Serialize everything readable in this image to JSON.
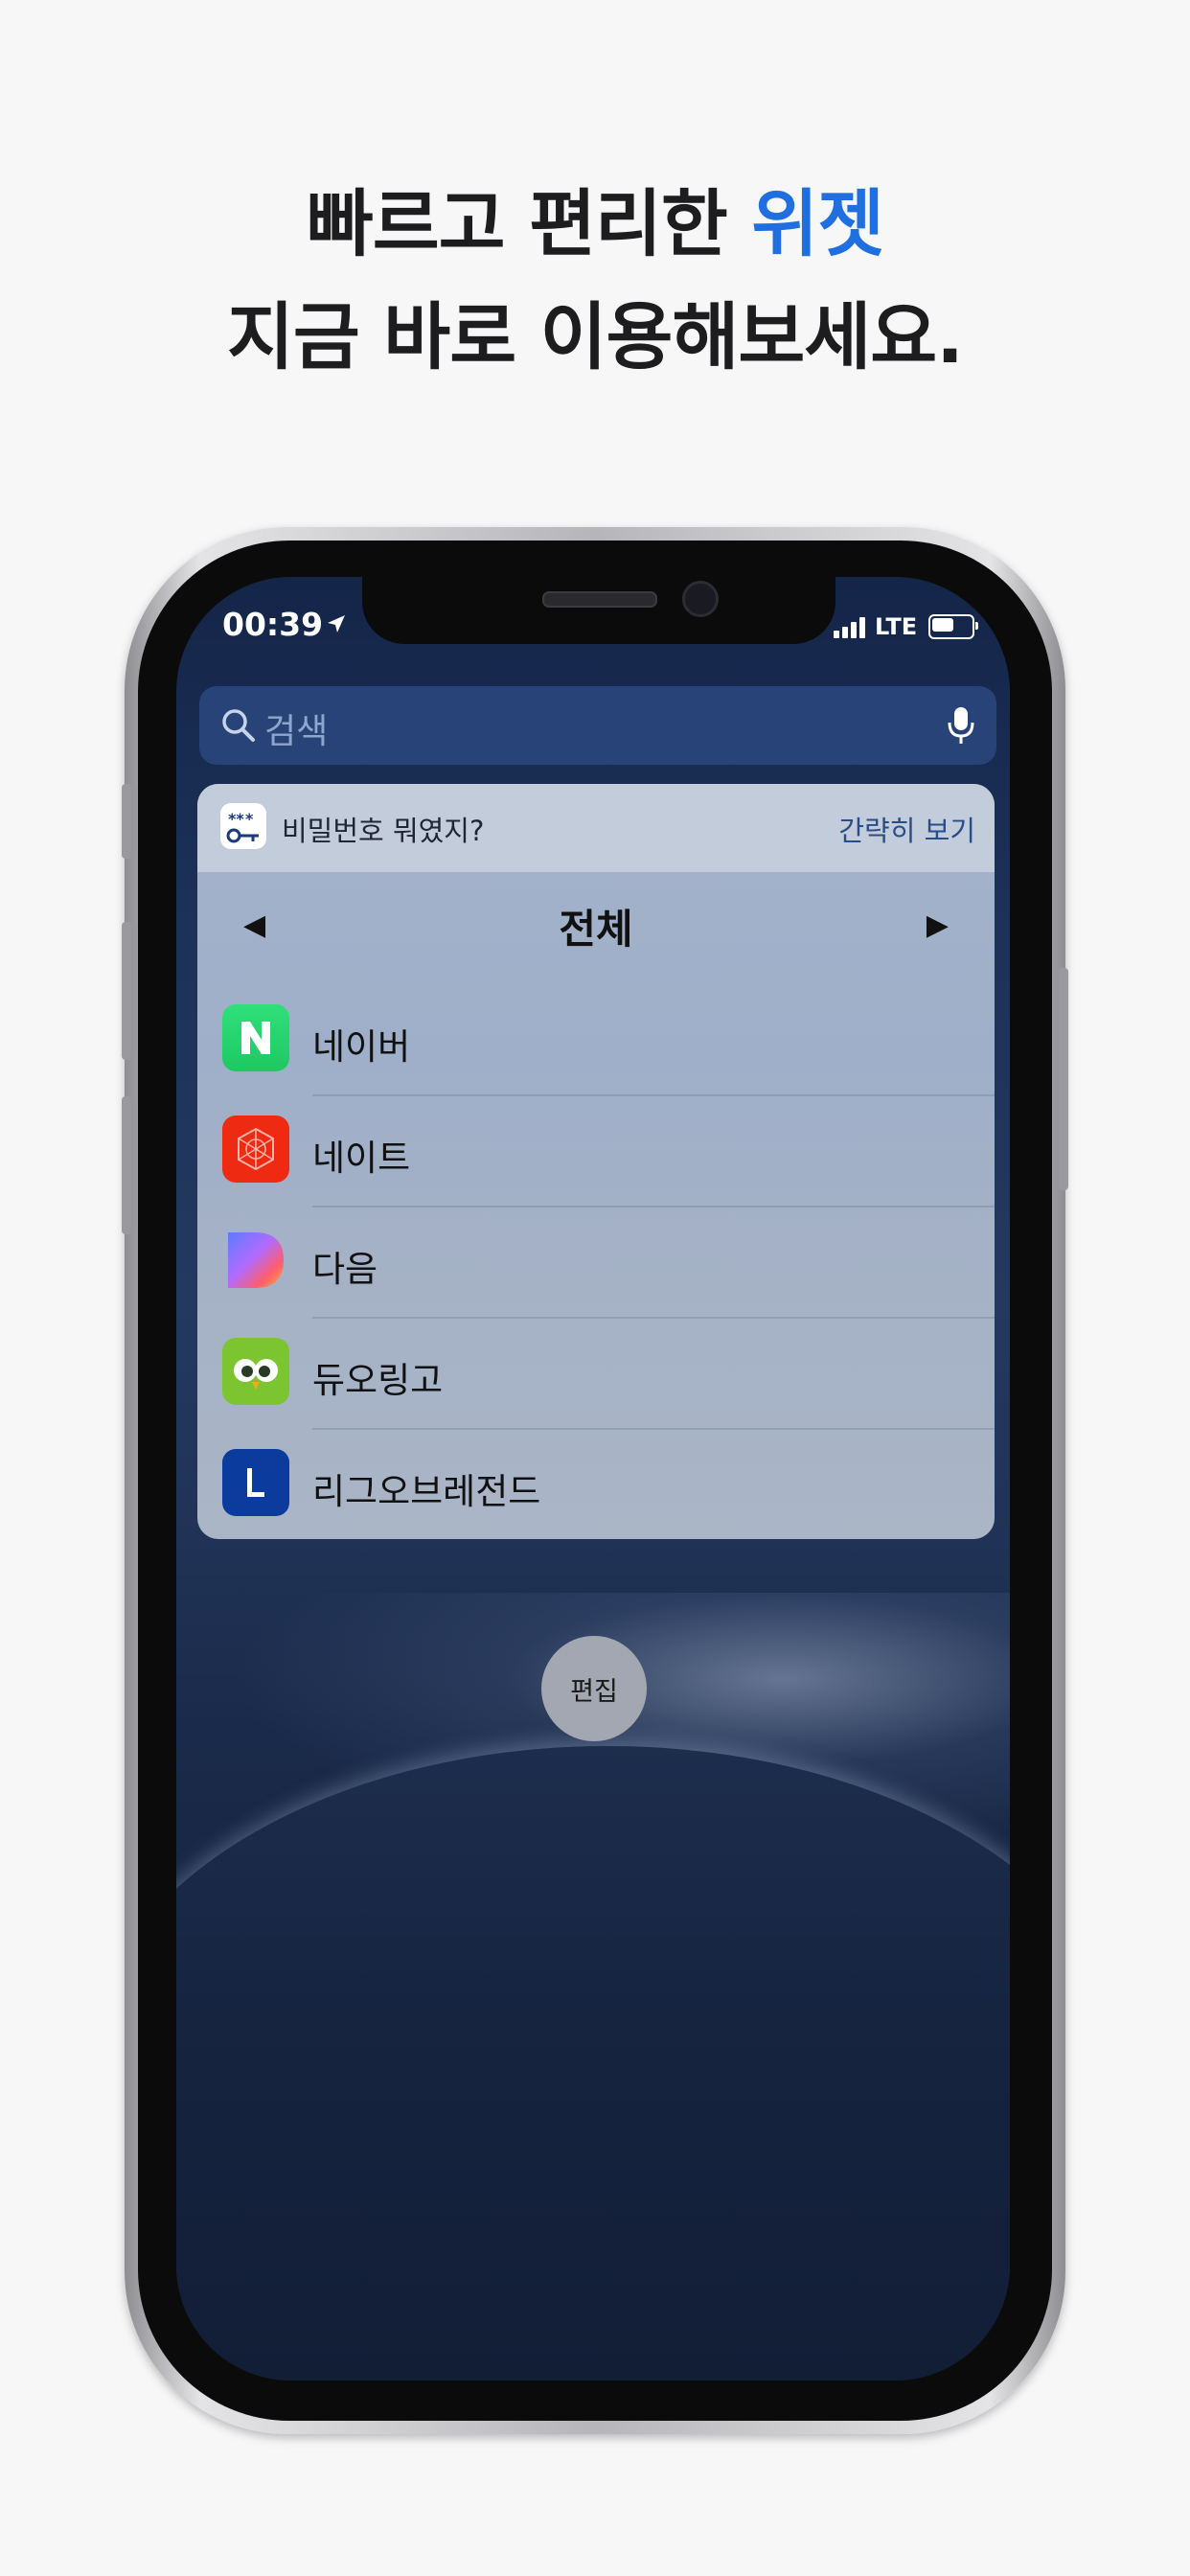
{
  "headline": {
    "line1_prefix": "빠르고 편리한 ",
    "line1_accent": "위젯",
    "line2": "지금 바로 이용해보세요.",
    "accent_color": "#1f6fe0"
  },
  "status_bar": {
    "time": "00:39",
    "network": "LTE",
    "location_icon": "location-arrow-icon"
  },
  "search": {
    "placeholder": "검색"
  },
  "widget": {
    "app_name": "비밀번호 뭐였지?",
    "toggle_label": "간략히 보기",
    "category": "전체",
    "prev_symbol": "◀",
    "next_symbol": "▶",
    "items": [
      {
        "label": "네이버",
        "icon": "naver-icon"
      },
      {
        "label": "네이트",
        "icon": "nate-icon"
      },
      {
        "label": "다음",
        "icon": "daum-icon"
      },
      {
        "label": "듀오링고",
        "icon": "duolingo-icon"
      },
      {
        "label": "리그오브레전드",
        "icon": "league-of-legends-icon"
      }
    ]
  },
  "edit_button": {
    "label": "편집"
  }
}
